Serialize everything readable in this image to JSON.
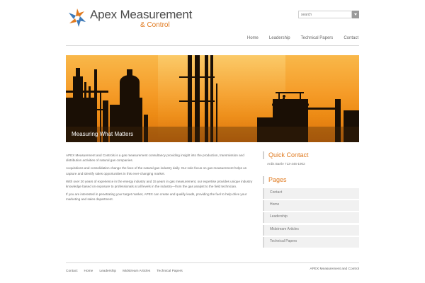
{
  "brand": {
    "name": "Apex Measurement",
    "sub": "& Control",
    "colors": {
      "accent": "#e07a1f",
      "logo_blue": "#3e7ab8"
    }
  },
  "search": {
    "placeholder": "search"
  },
  "nav": {
    "items": [
      "Home",
      "Leadership",
      "Technical Papers",
      "Contact"
    ]
  },
  "banner": {
    "caption": "Measuring What Matters"
  },
  "content": {
    "paragraphs": [
      "APEX Measurement and Controls is a gas measurement consultancy providing insight into the production, transmission and distribution activities of natural gas companies.",
      "Acquisitions and consolidation change the face of the natural gas industry daily. Our sole focus on gas measurement helps us capture and identify sales opportunities in this ever-changing market.",
      "With over 20 years of experience in the energy industry and 15 years in gas measurement, our expertise provides unique industry knowledge based on exposure to professionals at all levels in the industry—from the gas analyst to the field technician.",
      "If you are interested in penetrating your target market, APEX can create and qualify leads, providing the fuel to help drive your marketing and sales department."
    ]
  },
  "sidebar": {
    "contact_heading": "Quick Contact",
    "contact_text": "Ardis Bartle 713-446-1902",
    "pages_heading": "Pages",
    "pages": [
      "Contact",
      "Home",
      "Leadership",
      "Midstream Articles",
      "Technical Papers"
    ]
  },
  "footer": {
    "links": [
      "Contact",
      "Home",
      "Leadership",
      "Midstream Articles",
      "Technical Papers"
    ],
    "copyright": "APEX Measurement and Control"
  }
}
